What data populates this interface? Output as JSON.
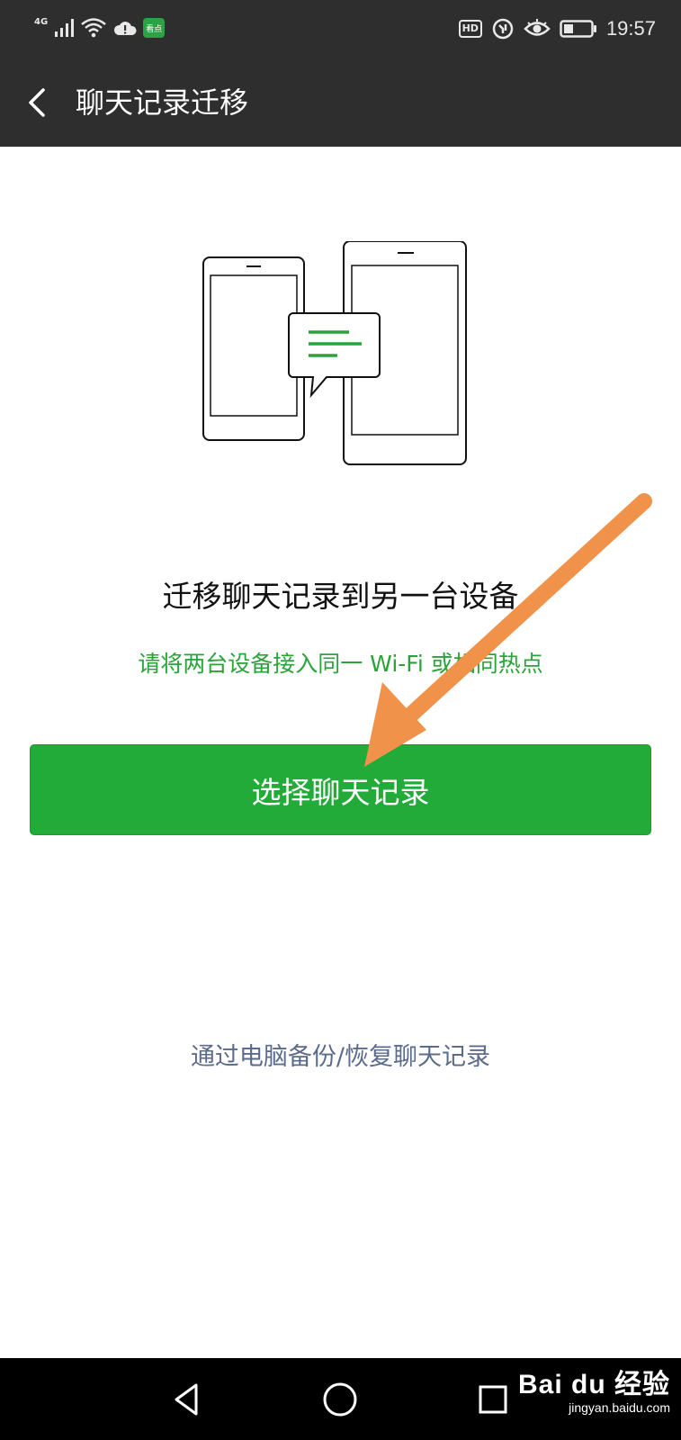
{
  "status_bar": {
    "network": "4G",
    "app_badge": "看点",
    "hd_badge": "HD",
    "time": "19:57"
  },
  "header": {
    "title": "聊天记录迁移"
  },
  "main": {
    "headline": "迁移聊天记录到另一台设备",
    "hint": "请将两台设备接入同一 Wi-Fi 或相同热点",
    "primary_button_label": "选择聊天记录",
    "pc_backup_link": "通过电脑备份/恢复聊天记录"
  },
  "watermark": {
    "main": "Bai du 经验",
    "sub": "jingyan.baidu.com"
  },
  "icons": [
    "back-chevron-icon",
    "phones-transfer-illustration",
    "annotation-arrow",
    "nav-back-icon",
    "nav-home-icon",
    "nav-recents-icon",
    "wifi-icon",
    "cloud-icon",
    "battery-icon",
    "eye-icon"
  ],
  "colors": {
    "accent_green": "#22ab39",
    "hint_green": "#2aa33a",
    "link_blue": "#5b6b8c",
    "bar_dark": "#2e2e2e",
    "arrow_orange": "#f0924a"
  }
}
